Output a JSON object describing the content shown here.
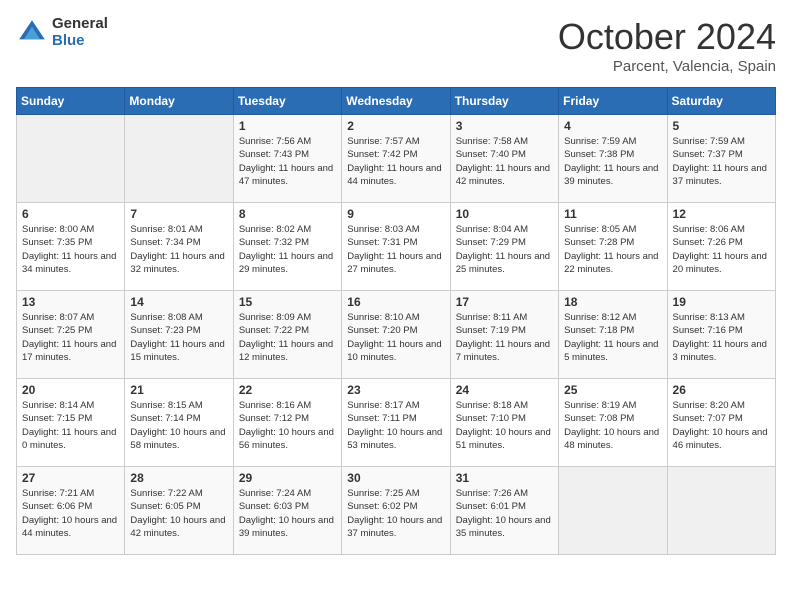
{
  "header": {
    "logo_general": "General",
    "logo_blue": "Blue",
    "month_title": "October 2024",
    "location": "Parcent, Valencia, Spain"
  },
  "weekdays": [
    "Sunday",
    "Monday",
    "Tuesday",
    "Wednesday",
    "Thursday",
    "Friday",
    "Saturday"
  ],
  "weeks": [
    [
      {
        "day": "",
        "sunrise": "",
        "sunset": "",
        "daylight": ""
      },
      {
        "day": "",
        "sunrise": "",
        "sunset": "",
        "daylight": ""
      },
      {
        "day": "1",
        "sunrise": "Sunrise: 7:56 AM",
        "sunset": "Sunset: 7:43 PM",
        "daylight": "Daylight: 11 hours and 47 minutes."
      },
      {
        "day": "2",
        "sunrise": "Sunrise: 7:57 AM",
        "sunset": "Sunset: 7:42 PM",
        "daylight": "Daylight: 11 hours and 44 minutes."
      },
      {
        "day": "3",
        "sunrise": "Sunrise: 7:58 AM",
        "sunset": "Sunset: 7:40 PM",
        "daylight": "Daylight: 11 hours and 42 minutes."
      },
      {
        "day": "4",
        "sunrise": "Sunrise: 7:59 AM",
        "sunset": "Sunset: 7:38 PM",
        "daylight": "Daylight: 11 hours and 39 minutes."
      },
      {
        "day": "5",
        "sunrise": "Sunrise: 7:59 AM",
        "sunset": "Sunset: 7:37 PM",
        "daylight": "Daylight: 11 hours and 37 minutes."
      }
    ],
    [
      {
        "day": "6",
        "sunrise": "Sunrise: 8:00 AM",
        "sunset": "Sunset: 7:35 PM",
        "daylight": "Daylight: 11 hours and 34 minutes."
      },
      {
        "day": "7",
        "sunrise": "Sunrise: 8:01 AM",
        "sunset": "Sunset: 7:34 PM",
        "daylight": "Daylight: 11 hours and 32 minutes."
      },
      {
        "day": "8",
        "sunrise": "Sunrise: 8:02 AM",
        "sunset": "Sunset: 7:32 PM",
        "daylight": "Daylight: 11 hours and 29 minutes."
      },
      {
        "day": "9",
        "sunrise": "Sunrise: 8:03 AM",
        "sunset": "Sunset: 7:31 PM",
        "daylight": "Daylight: 11 hours and 27 minutes."
      },
      {
        "day": "10",
        "sunrise": "Sunrise: 8:04 AM",
        "sunset": "Sunset: 7:29 PM",
        "daylight": "Daylight: 11 hours and 25 minutes."
      },
      {
        "day": "11",
        "sunrise": "Sunrise: 8:05 AM",
        "sunset": "Sunset: 7:28 PM",
        "daylight": "Daylight: 11 hours and 22 minutes."
      },
      {
        "day": "12",
        "sunrise": "Sunrise: 8:06 AM",
        "sunset": "Sunset: 7:26 PM",
        "daylight": "Daylight: 11 hours and 20 minutes."
      }
    ],
    [
      {
        "day": "13",
        "sunrise": "Sunrise: 8:07 AM",
        "sunset": "Sunset: 7:25 PM",
        "daylight": "Daylight: 11 hours and 17 minutes."
      },
      {
        "day": "14",
        "sunrise": "Sunrise: 8:08 AM",
        "sunset": "Sunset: 7:23 PM",
        "daylight": "Daylight: 11 hours and 15 minutes."
      },
      {
        "day": "15",
        "sunrise": "Sunrise: 8:09 AM",
        "sunset": "Sunset: 7:22 PM",
        "daylight": "Daylight: 11 hours and 12 minutes."
      },
      {
        "day": "16",
        "sunrise": "Sunrise: 8:10 AM",
        "sunset": "Sunset: 7:20 PM",
        "daylight": "Daylight: 11 hours and 10 minutes."
      },
      {
        "day": "17",
        "sunrise": "Sunrise: 8:11 AM",
        "sunset": "Sunset: 7:19 PM",
        "daylight": "Daylight: 11 hours and 7 minutes."
      },
      {
        "day": "18",
        "sunrise": "Sunrise: 8:12 AM",
        "sunset": "Sunset: 7:18 PM",
        "daylight": "Daylight: 11 hours and 5 minutes."
      },
      {
        "day": "19",
        "sunrise": "Sunrise: 8:13 AM",
        "sunset": "Sunset: 7:16 PM",
        "daylight": "Daylight: 11 hours and 3 minutes."
      }
    ],
    [
      {
        "day": "20",
        "sunrise": "Sunrise: 8:14 AM",
        "sunset": "Sunset: 7:15 PM",
        "daylight": "Daylight: 11 hours and 0 minutes."
      },
      {
        "day": "21",
        "sunrise": "Sunrise: 8:15 AM",
        "sunset": "Sunset: 7:14 PM",
        "daylight": "Daylight: 10 hours and 58 minutes."
      },
      {
        "day": "22",
        "sunrise": "Sunrise: 8:16 AM",
        "sunset": "Sunset: 7:12 PM",
        "daylight": "Daylight: 10 hours and 56 minutes."
      },
      {
        "day": "23",
        "sunrise": "Sunrise: 8:17 AM",
        "sunset": "Sunset: 7:11 PM",
        "daylight": "Daylight: 10 hours and 53 minutes."
      },
      {
        "day": "24",
        "sunrise": "Sunrise: 8:18 AM",
        "sunset": "Sunset: 7:10 PM",
        "daylight": "Daylight: 10 hours and 51 minutes."
      },
      {
        "day": "25",
        "sunrise": "Sunrise: 8:19 AM",
        "sunset": "Sunset: 7:08 PM",
        "daylight": "Daylight: 10 hours and 48 minutes."
      },
      {
        "day": "26",
        "sunrise": "Sunrise: 8:20 AM",
        "sunset": "Sunset: 7:07 PM",
        "daylight": "Daylight: 10 hours and 46 minutes."
      }
    ],
    [
      {
        "day": "27",
        "sunrise": "Sunrise: 7:21 AM",
        "sunset": "Sunset: 6:06 PM",
        "daylight": "Daylight: 10 hours and 44 minutes."
      },
      {
        "day": "28",
        "sunrise": "Sunrise: 7:22 AM",
        "sunset": "Sunset: 6:05 PM",
        "daylight": "Daylight: 10 hours and 42 minutes."
      },
      {
        "day": "29",
        "sunrise": "Sunrise: 7:24 AM",
        "sunset": "Sunset: 6:03 PM",
        "daylight": "Daylight: 10 hours and 39 minutes."
      },
      {
        "day": "30",
        "sunrise": "Sunrise: 7:25 AM",
        "sunset": "Sunset: 6:02 PM",
        "daylight": "Daylight: 10 hours and 37 minutes."
      },
      {
        "day": "31",
        "sunrise": "Sunrise: 7:26 AM",
        "sunset": "Sunset: 6:01 PM",
        "daylight": "Daylight: 10 hours and 35 minutes."
      },
      {
        "day": "",
        "sunrise": "",
        "sunset": "",
        "daylight": ""
      },
      {
        "day": "",
        "sunrise": "",
        "sunset": "",
        "daylight": ""
      }
    ]
  ]
}
